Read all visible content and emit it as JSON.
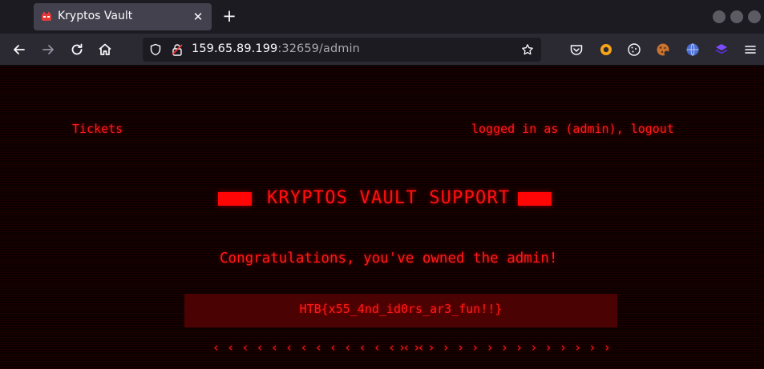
{
  "browser": {
    "tab_title": "Kryptos Vault",
    "tab_close_glyph": "✕",
    "new_tab_glyph": "+",
    "url_host": "159.65.89.199",
    "url_rest": ":32659/admin",
    "icons": [
      "back-icon",
      "forward-icon",
      "reload-icon",
      "home-icon",
      "shield-icon",
      "lock-warning-icon",
      "bookmark-star-icon",
      "pocket-icon",
      "extension-ring-icon",
      "cookie-icon",
      "cookie-editor-icon",
      "globe-icon",
      "layers-icon",
      "menu-icon"
    ]
  },
  "page": {
    "nav_tickets": "Tickets",
    "login_prefix": "logged in as (admin), ",
    "logout_label": "logout",
    "title": "KRYPTOS VAULT SUPPORT",
    "congrats": "Congratulations, you've owned the admin!",
    "flag": "HTB{x55_4nd_id0rs_ar3_fun!!}",
    "arrows_left": "‹ ‹ ‹ ‹ ‹ ‹ ‹ ‹ ‹ ‹ ‹ ‹ ‹ ‹ ‹",
    "arrows_right": "› › › › › › › › › › › › › › ›"
  },
  "colors": {
    "accent": "#ff1a1a",
    "page_bg": "#0d0000",
    "flag_bg": "#4a0202",
    "chrome_tabbar": "#1c1b22",
    "chrome_navbar": "#2b2a33"
  }
}
